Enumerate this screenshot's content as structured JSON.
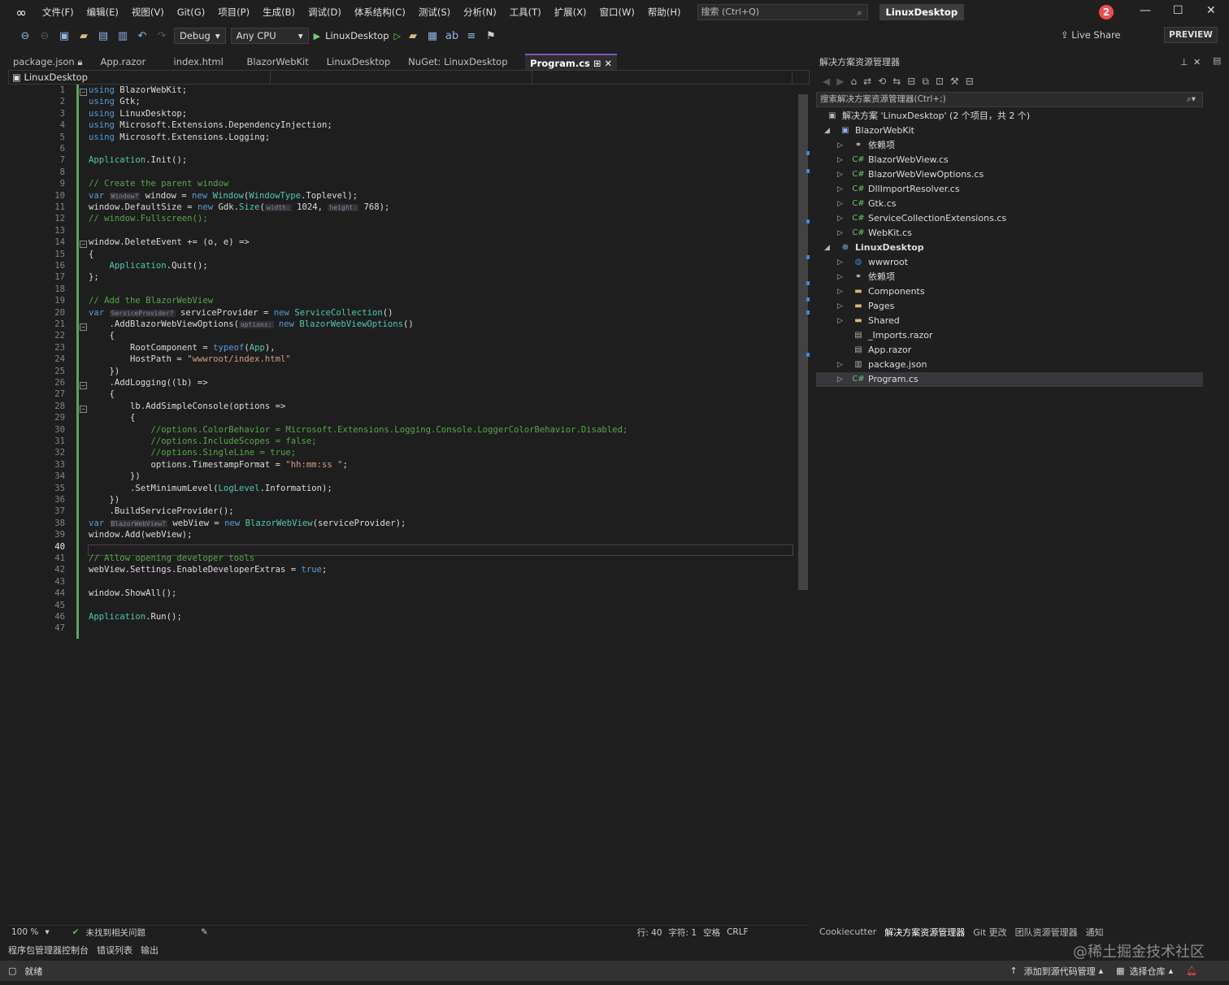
{
  "titlebar": {
    "menu": [
      "文件(F)",
      "编辑(E)",
      "视图(V)",
      "Git(G)",
      "项目(P)",
      "生成(B)",
      "调试(D)",
      "体系结构(C)",
      "测试(S)",
      "分析(N)",
      "工具(T)",
      "扩展(X)",
      "窗口(W)",
      "帮助(H)"
    ],
    "search_placeholder": "搜索 (Ctrl+Q)",
    "solution_name": "LinuxDesktop",
    "notification_count": "2"
  },
  "toolbar": {
    "config": "Debug",
    "platform": "Any CPU",
    "run_target": "LinuxDesktop",
    "live_share": "Live Share",
    "preview": "PREVIEW"
  },
  "tabs": [
    {
      "label": "package.json"
    },
    {
      "label": "App.razor"
    },
    {
      "label": "index.html"
    },
    {
      "label": "BlazorWebKit"
    },
    {
      "label": "LinuxDesktop"
    },
    {
      "label": "NuGet: LinuxDesktop"
    },
    {
      "label": "Program.cs"
    }
  ],
  "navbar": {
    "project": "LinuxDesktop"
  },
  "editor": {
    "line_numbers": [
      "1",
      "2",
      "3",
      "4",
      "5",
      "6",
      "7",
      "8",
      "9",
      "10",
      "11",
      "12",
      "13",
      "14",
      "15",
      "16",
      "17",
      "18",
      "19",
      "20",
      "21",
      "22",
      "23",
      "24",
      "25",
      "26",
      "27",
      "28",
      "29",
      "30",
      "31",
      "32",
      "33",
      "34",
      "35",
      "36",
      "37",
      "38",
      "39",
      "40",
      "41",
      "42",
      "43",
      "44",
      "45",
      "46",
      "47"
    ],
    "current_line": "40"
  },
  "editor_status": {
    "zoom": "100 %",
    "issues": "未找到相关问题",
    "line": "行: 40",
    "char": "字符: 1",
    "spaces": "空格",
    "eol": "CRLF"
  },
  "solution_explorer": {
    "title": "解决方案资源管理器",
    "search_placeholder": "搜索解决方案资源管理器(Ctrl+;)",
    "solution_label": "解决方案 'LinuxDesktop' (2 个项目，共 2 个)",
    "items": [
      {
        "label": "BlazorWebKit"
      },
      {
        "label": "依赖项"
      },
      {
        "label": "BlazorWebView.cs"
      },
      {
        "label": "BlazorWebViewOptions.cs"
      },
      {
        "label": "DllImportResolver.cs"
      },
      {
        "label": "Gtk.cs"
      },
      {
        "label": "ServiceCollectionExtensions.cs"
      },
      {
        "label": "WebKit.cs"
      },
      {
        "label": "LinuxDesktop"
      },
      {
        "label": "wwwroot"
      },
      {
        "label": "依赖项"
      },
      {
        "label": "Components"
      },
      {
        "label": "Pages"
      },
      {
        "label": "Shared"
      },
      {
        "label": "_Imports.razor"
      },
      {
        "label": "App.razor"
      },
      {
        "label": "package.json"
      },
      {
        "label": "Program.cs"
      }
    ]
  },
  "sol_tabs": [
    "Cookiecutter",
    "解决方案资源管理器",
    "Git 更改",
    "团队资源管理器",
    "通知"
  ],
  "bottom_tabs": [
    "程序包管理器控制台",
    "错误列表",
    "输出"
  ],
  "statusbar": {
    "ready": "就绪",
    "add_source": "添加到源代码管理",
    "select_repo": "选择仓库"
  },
  "watermark": "@稀土掘金技术社区"
}
